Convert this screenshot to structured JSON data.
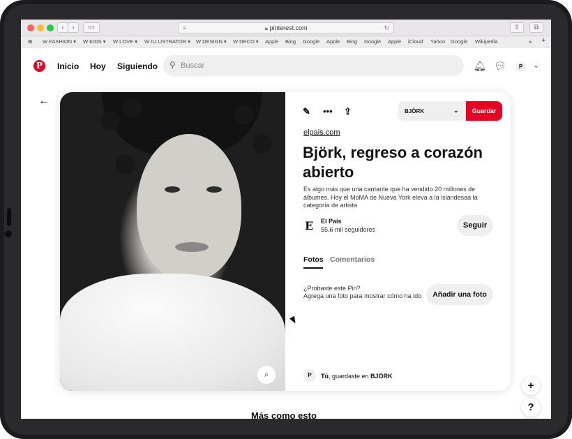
{
  "browser": {
    "url": "pinterest.com",
    "bookmarks": [
      "W FASHION ▾",
      "W KIDS ▾",
      "W LOVE ▾",
      "W ILLUSTRATOR ▾",
      "W DESIGN ▾",
      "W DECO ▾",
      "Apple",
      "Bing",
      "Google",
      "Apple",
      "Bing",
      "Google",
      "Apple",
      "iCloud",
      "Yahoo",
      "Google",
      "Wikipedia"
    ],
    "overflow": "»"
  },
  "header": {
    "logo_letter": "P",
    "nav": [
      "Inicio",
      "Hoy",
      "Siguiendo"
    ],
    "search_placeholder": "Buscar",
    "avatar_initial": "P"
  },
  "pin": {
    "board": "BJÖRK",
    "save_label": "Guardar",
    "domain": "elpais.com",
    "title": "Björk, regreso a corazón abierto",
    "description": "Es algo más que una cantante que ha vendido 20 millones de álbumes. Hoy el MoMA de Nueva York eleva a la islandesaa la categoría de artista",
    "source_logo": "E",
    "source_name": "El País",
    "source_followers": "55.6 mil seguidores",
    "follow_label": "Seguir",
    "tabs": [
      "Fotos",
      "Comentarios"
    ],
    "tried_question": "¿Probaste este Pin?",
    "tried_prompt": "Agrega una foto para mostrar cómo ha ido",
    "add_photo_label": "Añadir una foto",
    "activity_avatar": "P",
    "activity_user": "Tú",
    "activity_text": ", guardaste en ",
    "activity_board": "BJÖRK"
  },
  "more_like_this": "Más como esto",
  "float_buttons": [
    "+",
    "?"
  ]
}
